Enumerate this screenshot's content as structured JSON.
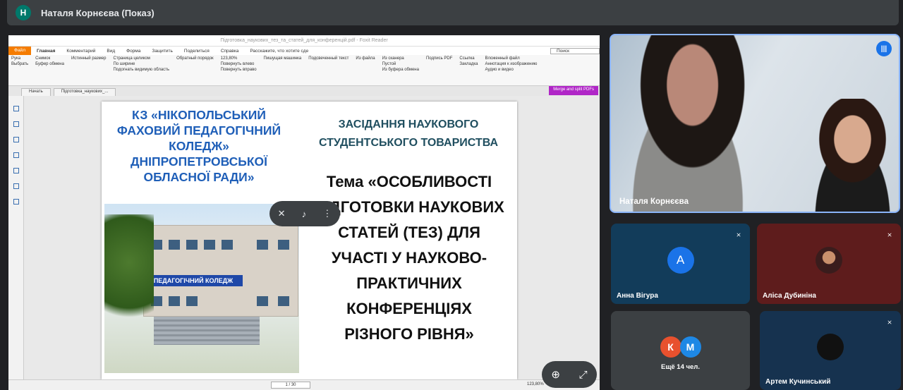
{
  "header": {
    "avatar_letter": "Н",
    "presenter": "Наталя Корнєєва (Показ)"
  },
  "reader": {
    "window_title": "Підготовка_наукових_тез_та_статей_для_конференцій.pdf - Foxit Reader",
    "tabs": [
      "Файл",
      "Главная",
      "Комментарий",
      "Вид",
      "Форма",
      "Защитить",
      "Поделиться",
      "Справка",
      "Расскажите, что хотите сде"
    ],
    "search_placeholder": "Поиск",
    "ribbon_groups": [
      "Рука",
      "Выбрать",
      "Снимок",
      "Буфер обмена",
      "Истинный размер",
      "Страница целиком",
      "По ширине",
      "Подогнать видимую область",
      "Обратный порядок",
      "123,80%",
      "Повернуть влево",
      "Повернуть вправо",
      "Пишущая машинка",
      "Подсвеченный текст",
      "Из файла",
      "Из сканера",
      "Пустой",
      "Из буфера обмена",
      "Подпись PDF",
      "Ссылка",
      "Закладка",
      "Вложенный файл",
      "Аннотация к изображению",
      "Аудио и видео"
    ],
    "doc_tab_start": "Начать",
    "doc_tab_file": "Підготовка_наукових_...",
    "merge_button": "Merge and split PDFs",
    "page_indicator": "1 / 30",
    "zoom_level": "123,80%"
  },
  "slide": {
    "left_title": "КЗ «НІКОПОЛЬСЬКИЙ ФАХОВИЙ ПЕДАГОГІЧНИЙ КОЛЕДЖ» ДНІПРОПЕТРОВСЬКОЇ ОБЛАСНОЇ РАДИ»",
    "right_heading": "ЗАСІДАННЯ НАУКОВОГО СТУДЕНТСЬКОГО ТОВАРИСТВА",
    "topic": "Тема «ОСОБЛИВОСТІ ПІДГОТОВКИ НАУКОВИХ СТАТЕЙ (ТЕЗ) ДЛЯ УЧАСТІ У НАУКОВО-ПРАКТИЧНИХ КОНФЕРЕНЦІЯХ РІЗНОГО РІВНЯ»",
    "building_sign": "ПЕДАГОГІЧНИЙ КОЛЕДЖ"
  },
  "participants": {
    "main": {
      "name": "Наталя Корнєєва"
    },
    "anna": {
      "letter": "А",
      "name": "Анна Вігура",
      "color": "#1a73e8"
    },
    "alisa": {
      "name": "Аліса Дубиніна"
    },
    "more": {
      "k": "К",
      "m": "М",
      "label": "Ещё 14 чел."
    },
    "artem": {
      "name": "Артем Кучинський"
    }
  }
}
